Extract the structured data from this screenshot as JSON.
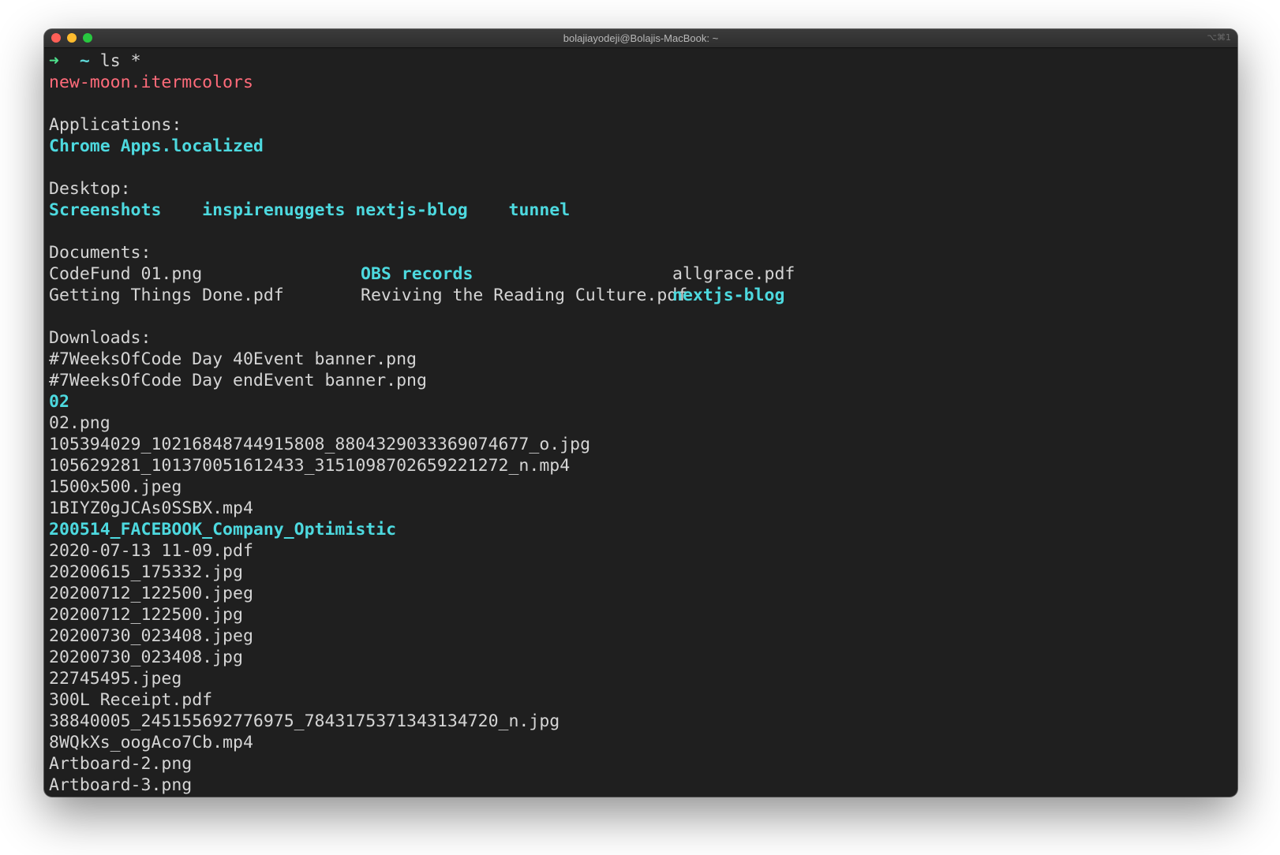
{
  "window": {
    "title": "bolajiayodeji@Bolajis-MacBook: ~",
    "shortcut": "⌥⌘1"
  },
  "prompt": {
    "arrow": "➜",
    "cwd": "~",
    "command": "ls *"
  },
  "root_file": "new-moon.itermcolors",
  "applications": {
    "heading": "Applications:",
    "items": [
      "Chrome Apps.localized"
    ]
  },
  "desktop": {
    "heading": "Desktop:",
    "items": [
      "Screenshots",
      "inspirenuggets",
      "nextjs-blog",
      "tunnel"
    ]
  },
  "documents": {
    "heading": "Documents:",
    "row1": [
      "CodeFund 01.png",
      "OBS records",
      "allgrace.pdf"
    ],
    "row2": [
      "Getting Things Done.pdf",
      "Reviving the Reading Culture.pdf",
      "nextjs-blog"
    ]
  },
  "downloads": {
    "heading": "Downloads:",
    "items": [
      "#7WeeksOfCode Day 40Event banner.png",
      "#7WeeksOfCode Day endEvent banner.png",
      "02",
      "02.png",
      "105394029_10216848744915808_8804329033369074677_o.jpg",
      "105629281_101370051612433_3151098702659221272_n.mp4",
      "1500x500.jpeg",
      "1BIYZ0gJCAs0SSBX.mp4",
      "200514_FACEBOOK_Company_Optimistic",
      "2020-07-13 11-09.pdf",
      "20200615_175332.jpg",
      "20200712_122500.jpeg",
      "20200712_122500.jpg",
      "20200730_023408.jpeg",
      "20200730_023408.jpg",
      "22745495.jpeg",
      "300L Receipt.pdf",
      "38840005_245155692776975_7843175371343134720_n.jpg",
      "8WQkXs_oogAco7Cb.mp4",
      "Artboard-2.png",
      "Artboard-3.png"
    ]
  },
  "colors": {
    "background": "#1f1f1f",
    "directory": "#4dd9df",
    "file": "#d5d5d5",
    "special_file": "#ff6b7a",
    "prompt_arrow": "#4ee08c"
  }
}
